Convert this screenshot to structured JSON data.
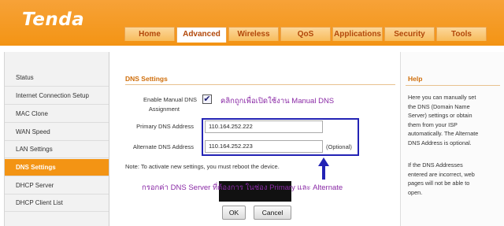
{
  "header": {
    "logo": "Tenda"
  },
  "tabs": [
    {
      "label": "Home"
    },
    {
      "label": "Advanced"
    },
    {
      "label": "Wireless"
    },
    {
      "label": "QoS"
    },
    {
      "label": "Applications"
    },
    {
      "label": "Security"
    },
    {
      "label": "Tools"
    }
  ],
  "active_tab": "Advanced",
  "sidebar": {
    "items": [
      {
        "label": "Status"
      },
      {
        "label": "Internet Connection Setup"
      },
      {
        "label": "MAC Clone"
      },
      {
        "label": "WAN Speed"
      },
      {
        "label": "LAN Settings"
      },
      {
        "label": "DNS Settings"
      },
      {
        "label": "DHCP Server"
      },
      {
        "label": "DHCP Client List"
      }
    ],
    "active": "DNS Settings"
  },
  "main": {
    "title": "DNS Settings",
    "manual_label_1": "Enable Manual DNS",
    "manual_label_2": "Assignment",
    "manual_checked": true,
    "manual_check_glyph": "✔",
    "annotation_checkbox": "คลิกถูกเพื่อเปิดใช้งาน Manual DNS",
    "primary_label": "Primary DNS Address",
    "primary_value": "110.164.252.222",
    "alternate_label": "Alternate DNS Address",
    "alternate_value": "110.164.252.223",
    "optional_text": "(Optional)",
    "note": "Note: To activate new settings, you must reboot the device.",
    "annotation_fields": "กรอกค่า DNS Server ที่ต้องการ ในช่อง Primary และ Alternate",
    "ok_label": "OK",
    "cancel_label": "Cancel"
  },
  "help": {
    "title": "Help",
    "para1_lines": [
      "Here you can manually set",
      "the DNS (Domain Name",
      "Server) settings or obtain",
      "them from your ISP",
      "automatically. The Alternate",
      "DNS Address is optional."
    ],
    "para2_lines": [
      "If the DNS Addresses",
      "entered are incorrect, web",
      "pages will not be able to",
      "open."
    ]
  },
  "colors": {
    "brand_orange": "#f39414",
    "annotation_purple": "#8a2aa6",
    "highlight_blue": "#2323b5"
  }
}
